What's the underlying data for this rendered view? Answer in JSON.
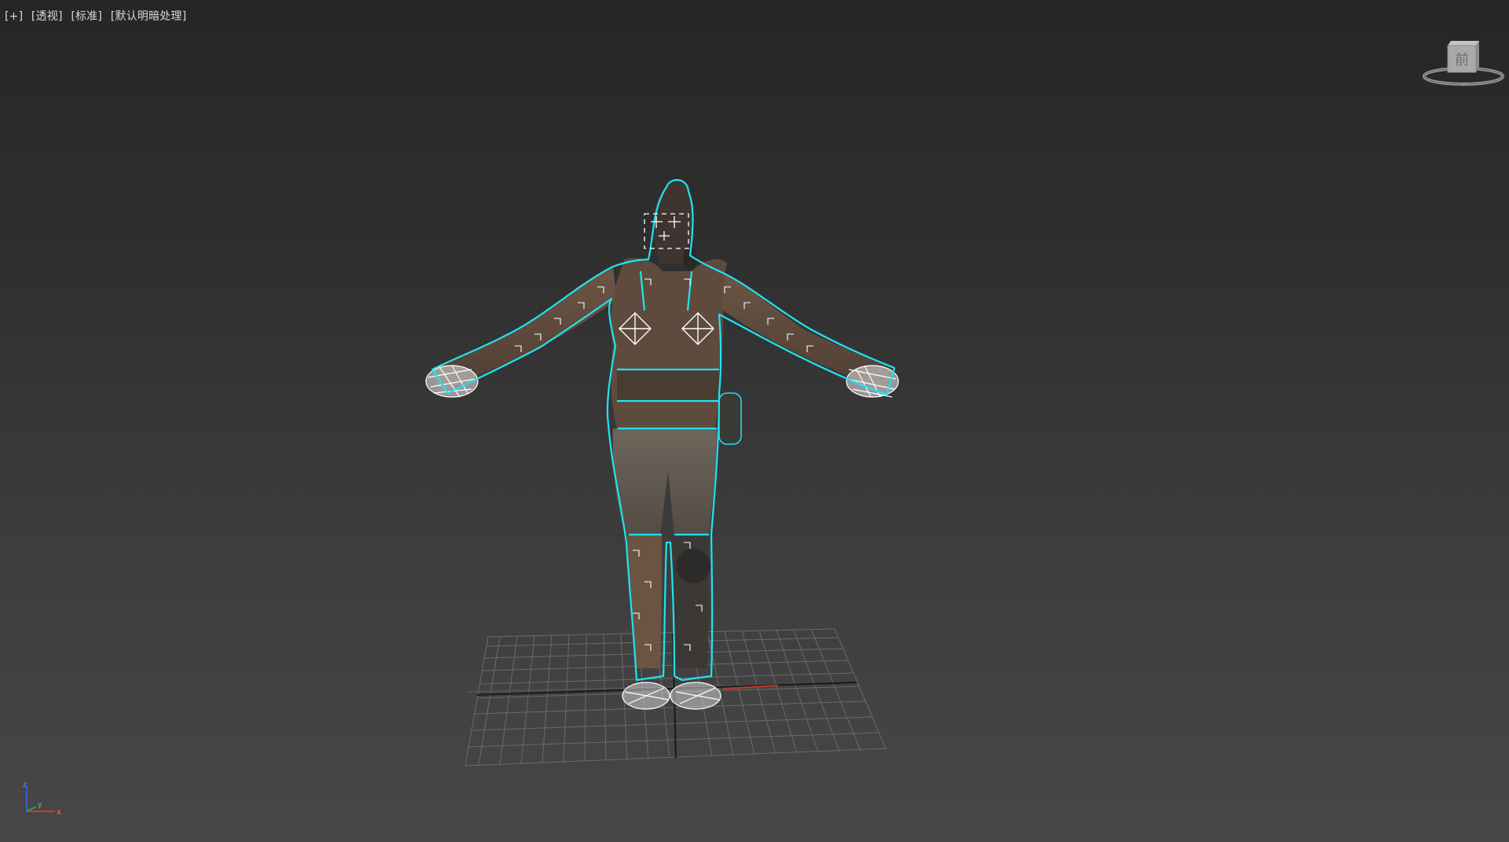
{
  "viewport": {
    "labels": [
      "[+]",
      "[透视]",
      "[标准]",
      "[默认明暗处理]"
    ]
  },
  "viewcube": {
    "face_label": "前",
    "icon": "viewcube-icon"
  },
  "axis_tripod": {
    "x_label": "x",
    "y_label": "y",
    "z_label": "z",
    "colors": {
      "x": "#d23a2a",
      "y": "#2aa84a",
      "z": "#3a5ad8"
    }
  },
  "selection_color": "#1fe3f0"
}
